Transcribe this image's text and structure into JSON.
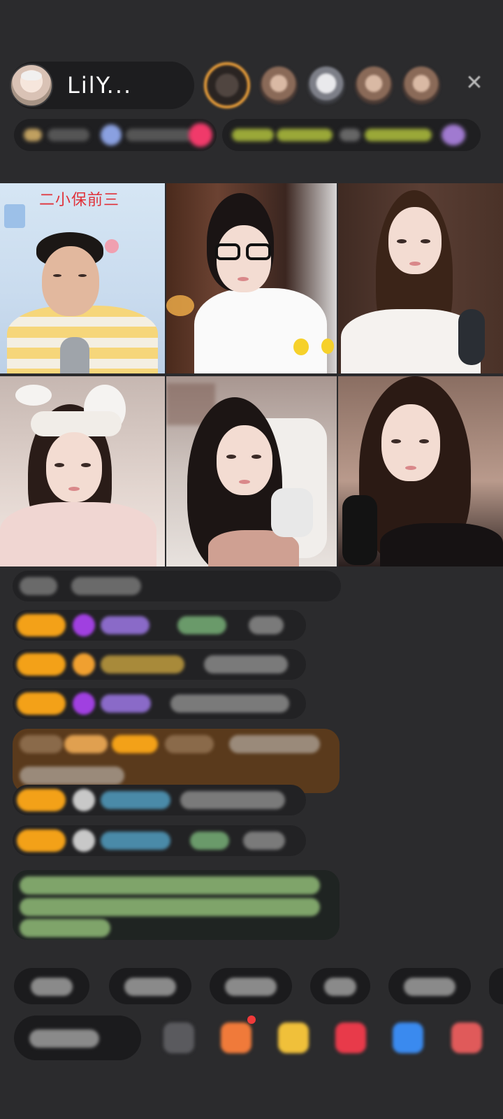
{
  "header": {
    "host_name": "LilY..."
  },
  "grid": {
    "seat1_caption": "二小保前三"
  },
  "colors": {
    "background": "#2b2b2d",
    "pill": "#1d1d1f",
    "badge_orange": "#f3a118",
    "chat_gold_box": "#5a3a1c",
    "caption_red": "#e0323a"
  },
  "icons": {
    "close": "close-icon",
    "gift": "gift-icon",
    "emoji": "emoji-icon",
    "more": "more-icon"
  }
}
